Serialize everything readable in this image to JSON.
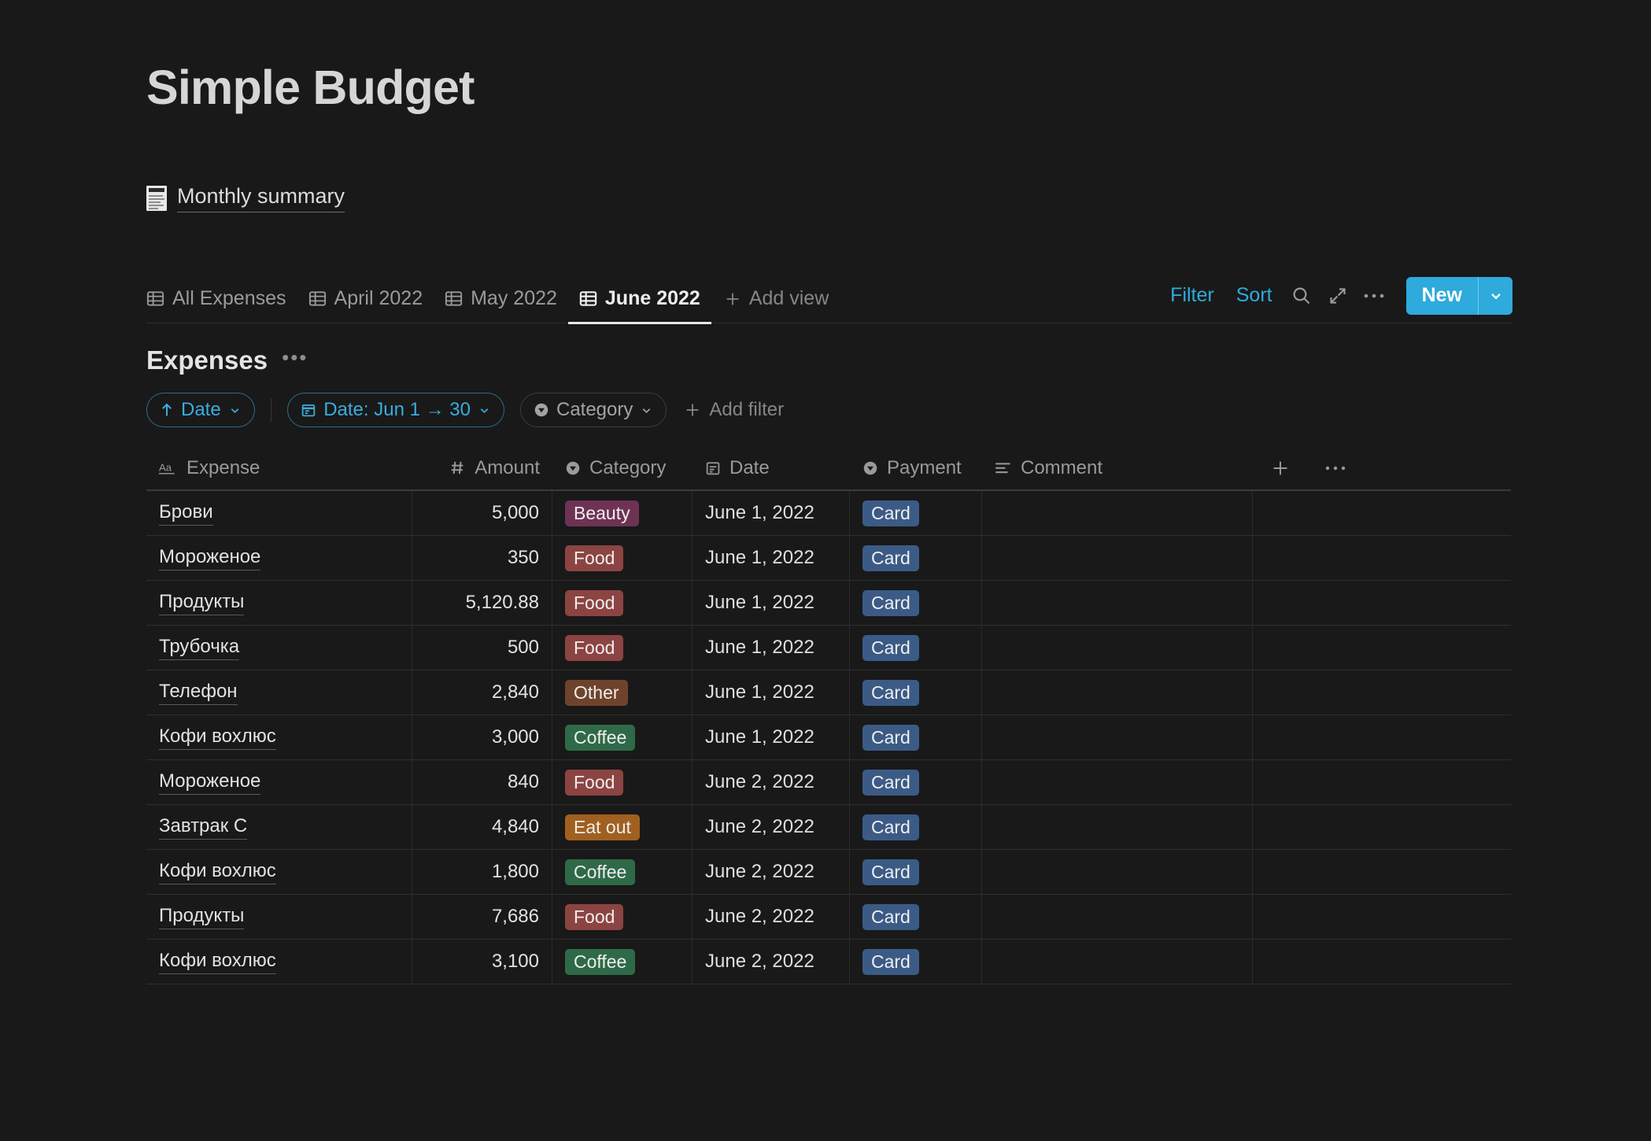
{
  "page": {
    "title": "Simple Budget",
    "summary_link": {
      "icon": "receipt-icon",
      "label": "Monthly summary"
    }
  },
  "views": {
    "tabs": [
      {
        "label": "All Expenses",
        "icon": "table-icon",
        "active": false
      },
      {
        "label": "April 2022",
        "icon": "table-icon",
        "active": false
      },
      {
        "label": "May 2022",
        "icon": "table-icon",
        "active": false
      },
      {
        "label": "June 2022",
        "icon": "table-icon",
        "active": true
      }
    ],
    "add_view_label": "Add view"
  },
  "toolbar": {
    "filter_label": "Filter",
    "sort_label": "Sort",
    "search_icon": "search-icon",
    "expand_icon": "expand-icon",
    "more_icon": "more-options-icon",
    "new_label": "New",
    "new_chevron_icon": "chevron-down-icon",
    "accent_color": "#2eaadc"
  },
  "database": {
    "name": "Expenses",
    "more_label": "•••",
    "filters": [
      {
        "id": "sort-date",
        "icon": "arrow-up-icon",
        "label": "Date",
        "chevron": "⌄",
        "style": "blue"
      },
      {
        "id": "date-range",
        "icon": "calendar-icon",
        "label": "Date: Jun 1 → 30",
        "chevron": "⌄",
        "style": "blue"
      },
      {
        "id": "category",
        "icon": "select-icon",
        "label": "Category",
        "chevron": "⌄",
        "style": "gray"
      }
    ],
    "add_filter_label": "Add filter",
    "columns": [
      {
        "key": "expense",
        "label": "Expense",
        "icon": "text-type-icon"
      },
      {
        "key": "amount",
        "label": "Amount",
        "icon": "number-type-icon"
      },
      {
        "key": "category",
        "label": "Category",
        "icon": "select-type-icon"
      },
      {
        "key": "date",
        "label": "Date",
        "icon": "date-type-icon"
      },
      {
        "key": "payment",
        "label": "Payment",
        "icon": "select-type-icon"
      },
      {
        "key": "comment",
        "label": "Comment",
        "icon": "text-lines-icon"
      }
    ],
    "add_column_icon": "plus-icon",
    "column_options_icon": "more-options-icon",
    "rows": [
      {
        "expense": "Брови",
        "amount": "5,000",
        "category": "Beauty",
        "date": "June 1, 2022",
        "payment": "Card",
        "comment": ""
      },
      {
        "expense": "Мороженое",
        "amount": "350",
        "category": "Food",
        "date": "June 1, 2022",
        "payment": "Card",
        "comment": ""
      },
      {
        "expense": "Продукты",
        "amount": "5,120.88",
        "category": "Food",
        "date": "June 1, 2022",
        "payment": "Card",
        "comment": ""
      },
      {
        "expense": "Трубочка",
        "amount": "500",
        "category": "Food",
        "date": "June 1, 2022",
        "payment": "Card",
        "comment": ""
      },
      {
        "expense": "Телефон",
        "amount": "2,840",
        "category": "Other",
        "date": "June 1, 2022",
        "payment": "Card",
        "comment": ""
      },
      {
        "expense": "Кофи вохлюс",
        "amount": "3,000",
        "category": "Coffee",
        "date": "June 1, 2022",
        "payment": "Card",
        "comment": ""
      },
      {
        "expense": "Мороженое",
        "amount": "840",
        "category": "Food",
        "date": "June 2, 2022",
        "payment": "Card",
        "comment": ""
      },
      {
        "expense": "Завтрак С",
        "amount": "4,840",
        "category": "Eat out",
        "date": "June 2, 2022",
        "payment": "Card",
        "comment": ""
      },
      {
        "expense": "Кофи вохлюс",
        "amount": "1,800",
        "category": "Coffee",
        "date": "June 2, 2022",
        "payment": "Card",
        "comment": ""
      },
      {
        "expense": "Продукты",
        "amount": "7,686",
        "category": "Food",
        "date": "June 2, 2022",
        "payment": "Card",
        "comment": ""
      },
      {
        "expense": "Кофи вохлюс",
        "amount": "3,100",
        "category": "Coffee",
        "date": "June 2, 2022",
        "payment": "Card",
        "comment": ""
      }
    ],
    "tag_colors": {
      "Beauty": "#6e3354",
      "Food": "#8b4442",
      "Other": "#6f432b",
      "Coffee": "#2f6a48",
      "Eat out": "#a0601f",
      "Card": "#3b5b86"
    }
  },
  "theme": {
    "background": "#191919",
    "text_primary": "#e2e2e1",
    "text_secondary": "#9a9a99",
    "border": "#2f2f2f"
  }
}
